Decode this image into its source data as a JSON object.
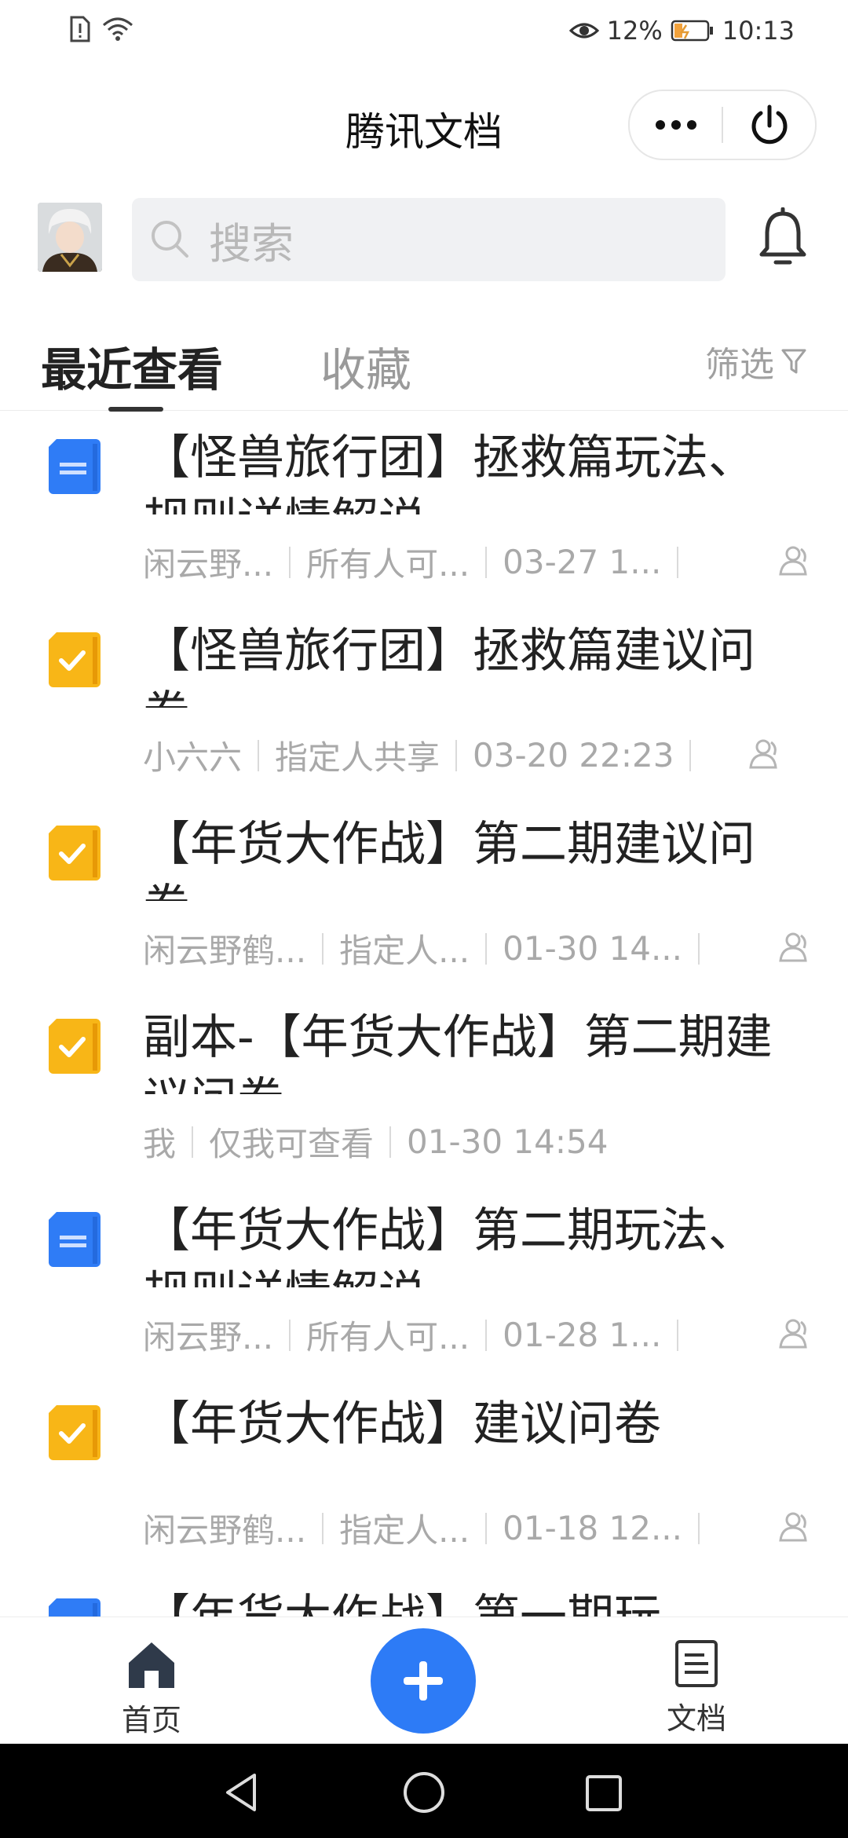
{
  "status_bar": {
    "battery_percent": "12%",
    "time": "10:13",
    "icons": [
      "sim-alert-icon",
      "wifi-icon",
      "eye-comfort-icon",
      "battery-icon"
    ]
  },
  "header": {
    "title": "腾讯文档",
    "more_icon": "more-dots-icon",
    "close_icon": "power-icon"
  },
  "search": {
    "placeholder": "搜索"
  },
  "tabs": {
    "recent": "最近查看",
    "favorites": "收藏",
    "filter": "筛选"
  },
  "documents": [
    {
      "type": "doc",
      "title": "【怪兽旅行团】拯救篇玩法、规则详情解说",
      "owner": "闲云野...",
      "permission": "所有人可...",
      "time": "03-27 1...",
      "shared": true
    },
    {
      "type": "form",
      "title": "【怪兽旅行团】拯救篇建议问卷",
      "owner": "小六六",
      "permission": "指定人共享",
      "time": "03-20 22:23",
      "shared": true
    },
    {
      "type": "form",
      "title": "【年货大作战】第二期建议问卷",
      "owner": "闲云野鹤...",
      "permission": "指定人...",
      "time": "01-30 14...",
      "shared": true
    },
    {
      "type": "form",
      "title": "副本-【年货大作战】第二期建议问卷",
      "owner": "我",
      "permission": "仅我可查看",
      "time": "01-30 14:54",
      "shared": false
    },
    {
      "type": "doc",
      "title": "【年货大作战】第二期玩法、规则详情解说",
      "owner": "闲云野...",
      "permission": "所有人可...",
      "time": "01-28 1...",
      "shared": true
    },
    {
      "type": "form",
      "title": "【年货大作战】建议问卷",
      "owner": "闲云野鹤...",
      "permission": "指定人...",
      "time": "01-18 12...",
      "shared": true
    },
    {
      "type": "doc",
      "title": "【年货大作战】第一期玩",
      "owner": "",
      "permission": "",
      "time": "",
      "shared": false
    }
  ],
  "bottom_nav": {
    "home": "首页",
    "docs": "文档",
    "add_icon": "plus-icon"
  },
  "colors": {
    "accent": "#2d7bf6",
    "doc_icon": "#2f7cf6",
    "form_icon": "#f8b617"
  }
}
